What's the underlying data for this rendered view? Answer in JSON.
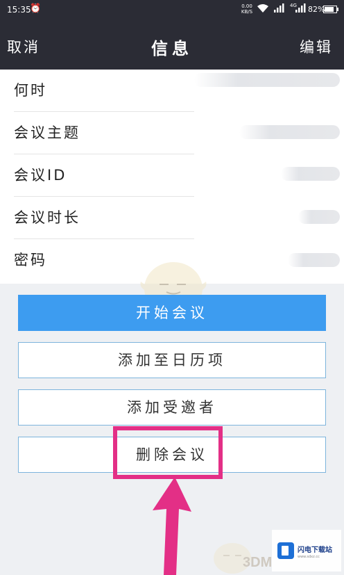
{
  "status_bar": {
    "time": "15:35",
    "net_speed_value": "0.00",
    "net_speed_unit": "KB/S",
    "network_type": "4G",
    "battery": "82%",
    "battery_level": 0.82
  },
  "nav": {
    "cancel_label": "取消",
    "title": "信息",
    "edit_label": "编辑"
  },
  "fields": [
    {
      "label": "何时"
    },
    {
      "label": "会议主题"
    },
    {
      "label": "会议ID"
    },
    {
      "label": "会议时长"
    },
    {
      "label": "密码"
    }
  ],
  "buttons": {
    "start_meeting": "开始会议",
    "add_to_calendar": "添加至日历项",
    "add_invitees": "添加受邀者",
    "delete_meeting": "删除会议"
  },
  "colors": {
    "header_bg": "#2b2c35",
    "primary_button": "#3d9cf0",
    "highlight": "#e32f86"
  },
  "watermark": {
    "brand": "3DM",
    "site_name": "闪电下载站",
    "site_url": "www.sdxz.cc"
  }
}
